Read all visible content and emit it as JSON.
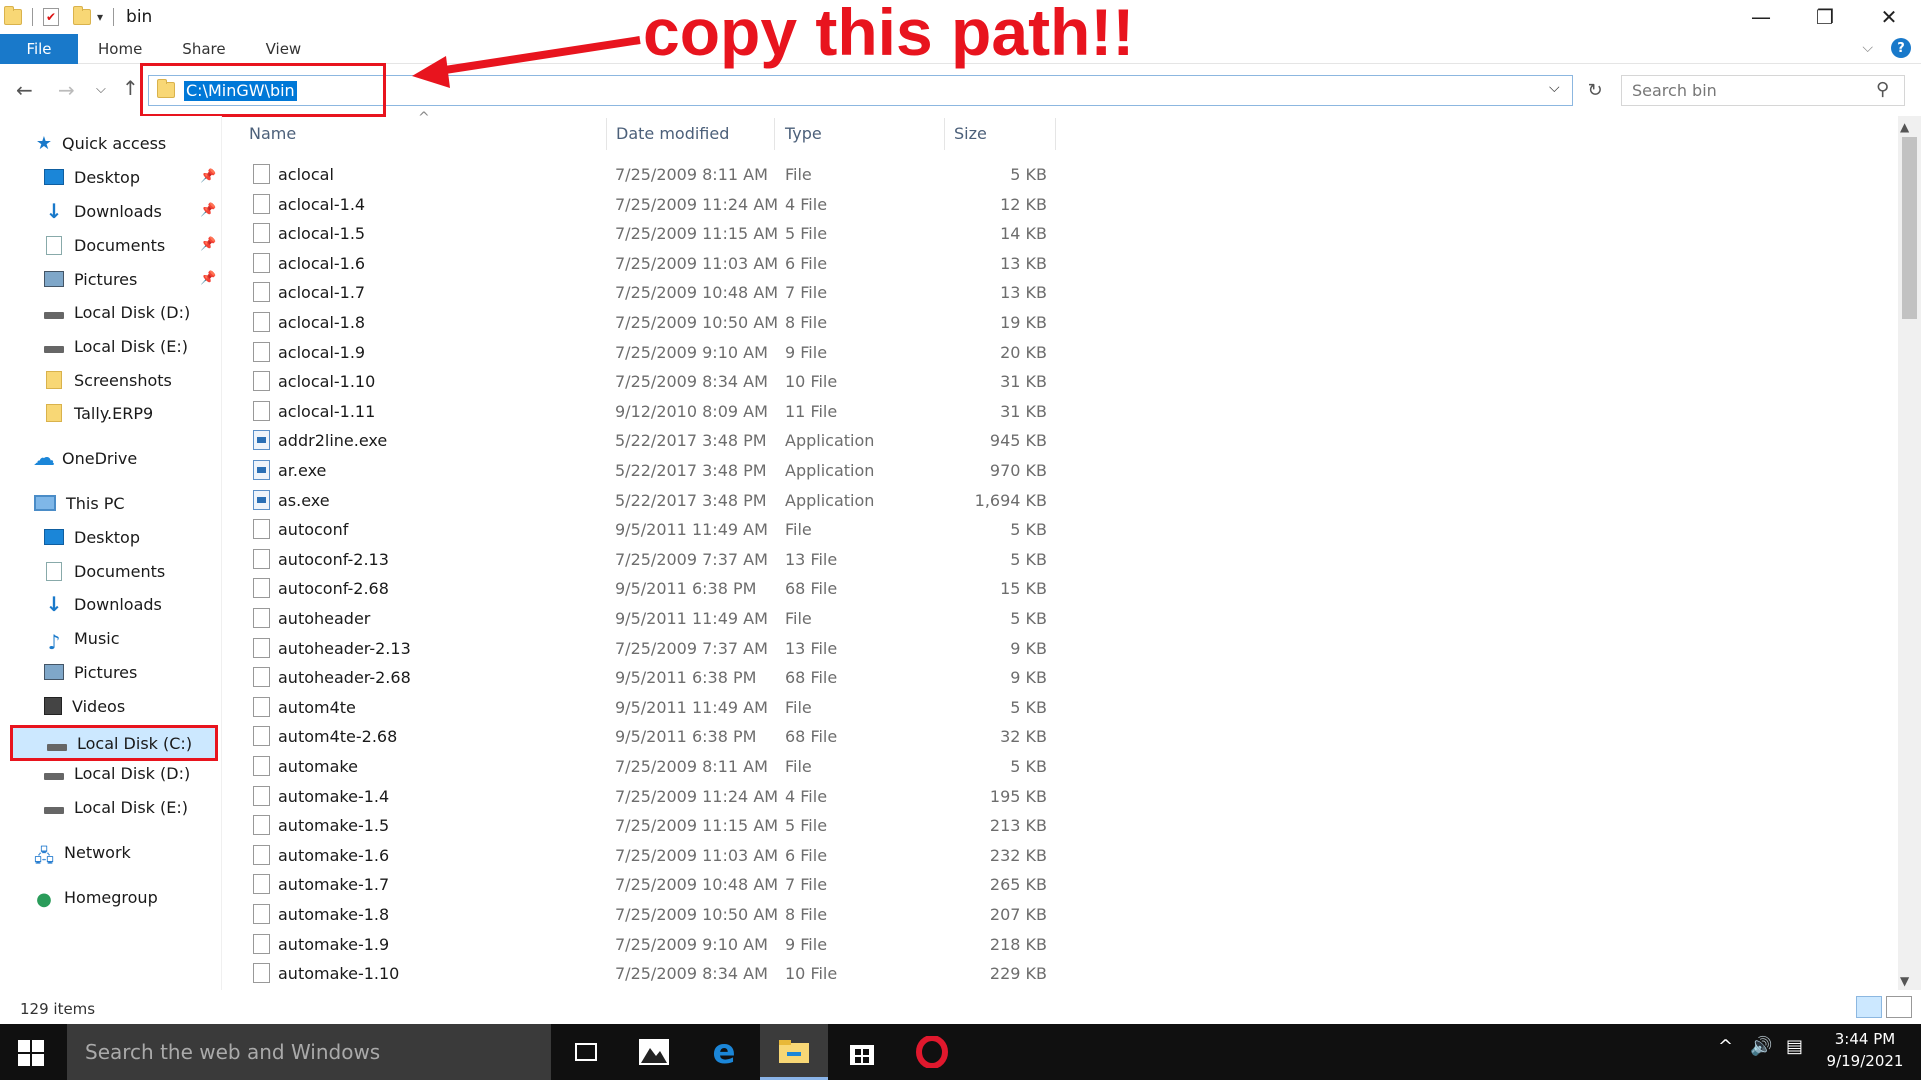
{
  "window": {
    "title": "bin",
    "controls": {
      "minimize": "—",
      "restore": "❐",
      "close": "✕"
    }
  },
  "ribbon": {
    "tabs": [
      "File",
      "Home",
      "Share",
      "View"
    ],
    "help": "?"
  },
  "address": {
    "path": "C:\\MinGW\\bin",
    "search_placeholder": "Search bin"
  },
  "annotation": {
    "text": "copy this path!!",
    "color": "#e8141e"
  },
  "nav": {
    "quick_access": "Quick access",
    "quick_items": [
      "Desktop",
      "Downloads",
      "Documents",
      "Pictures",
      "Local Disk (D:)",
      "Local Disk (E:)",
      "Screenshots",
      "Tally.ERP9"
    ],
    "onedrive": "OneDrive",
    "this_pc": "This PC",
    "pc_items": [
      "Desktop",
      "Documents",
      "Downloads",
      "Music",
      "Pictures",
      "Videos",
      "Local Disk (C:)",
      "Local Disk (D:)",
      "Local Disk (E:)"
    ],
    "network": "Network",
    "homegroup": "Homegroup"
  },
  "columns": {
    "name": "Name",
    "date": "Date modified",
    "type": "Type",
    "size": "Size"
  },
  "files": [
    {
      "name": "aclocal",
      "date": "7/25/2009 8:11 AM",
      "type": "File",
      "size": "5 KB",
      "icon": "file"
    },
    {
      "name": "aclocal-1.4",
      "date": "7/25/2009 11:24 AM",
      "type": "4 File",
      "size": "12 KB",
      "icon": "file"
    },
    {
      "name": "aclocal-1.5",
      "date": "7/25/2009 11:15 AM",
      "type": "5 File",
      "size": "14 KB",
      "icon": "file"
    },
    {
      "name": "aclocal-1.6",
      "date": "7/25/2009 11:03 AM",
      "type": "6 File",
      "size": "13 KB",
      "icon": "file"
    },
    {
      "name": "aclocal-1.7",
      "date": "7/25/2009 10:48 AM",
      "type": "7 File",
      "size": "13 KB",
      "icon": "file"
    },
    {
      "name": "aclocal-1.8",
      "date": "7/25/2009 10:50 AM",
      "type": "8 File",
      "size": "19 KB",
      "icon": "file"
    },
    {
      "name": "aclocal-1.9",
      "date": "7/25/2009 9:10 AM",
      "type": "9 File",
      "size": "20 KB",
      "icon": "file"
    },
    {
      "name": "aclocal-1.10",
      "date": "7/25/2009 8:34 AM",
      "type": "10 File",
      "size": "31 KB",
      "icon": "file"
    },
    {
      "name": "aclocal-1.11",
      "date": "9/12/2010 8:09 AM",
      "type": "11 File",
      "size": "31 KB",
      "icon": "file"
    },
    {
      "name": "addr2line.exe",
      "date": "5/22/2017 3:48 PM",
      "type": "Application",
      "size": "945 KB",
      "icon": "app"
    },
    {
      "name": "ar.exe",
      "date": "5/22/2017 3:48 PM",
      "type": "Application",
      "size": "970 KB",
      "icon": "app"
    },
    {
      "name": "as.exe",
      "date": "5/22/2017 3:48 PM",
      "type": "Application",
      "size": "1,694 KB",
      "icon": "app"
    },
    {
      "name": "autoconf",
      "date": "9/5/2011 11:49 AM",
      "type": "File",
      "size": "5 KB",
      "icon": "file"
    },
    {
      "name": "autoconf-2.13",
      "date": "7/25/2009 7:37 AM",
      "type": "13 File",
      "size": "5 KB",
      "icon": "file"
    },
    {
      "name": "autoconf-2.68",
      "date": "9/5/2011 6:38 PM",
      "type": "68 File",
      "size": "15 KB",
      "icon": "file"
    },
    {
      "name": "autoheader",
      "date": "9/5/2011 11:49 AM",
      "type": "File",
      "size": "5 KB",
      "icon": "file"
    },
    {
      "name": "autoheader-2.13",
      "date": "7/25/2009 7:37 AM",
      "type": "13 File",
      "size": "9 KB",
      "icon": "file"
    },
    {
      "name": "autoheader-2.68",
      "date": "9/5/2011 6:38 PM",
      "type": "68 File",
      "size": "9 KB",
      "icon": "file"
    },
    {
      "name": "autom4te",
      "date": "9/5/2011 11:49 AM",
      "type": "File",
      "size": "5 KB",
      "icon": "file"
    },
    {
      "name": "autom4te-2.68",
      "date": "9/5/2011 6:38 PM",
      "type": "68 File",
      "size": "32 KB",
      "icon": "file"
    },
    {
      "name": "automake",
      "date": "7/25/2009 8:11 AM",
      "type": "File",
      "size": "5 KB",
      "icon": "file"
    },
    {
      "name": "automake-1.4",
      "date": "7/25/2009 11:24 AM",
      "type": "4 File",
      "size": "195 KB",
      "icon": "file"
    },
    {
      "name": "automake-1.5",
      "date": "7/25/2009 11:15 AM",
      "type": "5 File",
      "size": "213 KB",
      "icon": "file"
    },
    {
      "name": "automake-1.6",
      "date": "7/25/2009 11:03 AM",
      "type": "6 File",
      "size": "232 KB",
      "icon": "file"
    },
    {
      "name": "automake-1.7",
      "date": "7/25/2009 10:48 AM",
      "type": "7 File",
      "size": "265 KB",
      "icon": "file"
    },
    {
      "name": "automake-1.8",
      "date": "7/25/2009 10:50 AM",
      "type": "8 File",
      "size": "207 KB",
      "icon": "file"
    },
    {
      "name": "automake-1.9",
      "date": "7/25/2009 9:10 AM",
      "type": "9 File",
      "size": "218 KB",
      "icon": "file"
    },
    {
      "name": "automake-1.10",
      "date": "7/25/2009 8:34 AM",
      "type": "10 File",
      "size": "229 KB",
      "icon": "file"
    }
  ],
  "status": {
    "count": "129 items"
  },
  "taskbar": {
    "search_placeholder": "Search the web and Windows",
    "time": "3:44 PM",
    "date": "9/19/2021"
  },
  "colors": {
    "accent": "#1979ca",
    "highlight_red": "#e8141e",
    "taskbar": "#101010"
  }
}
